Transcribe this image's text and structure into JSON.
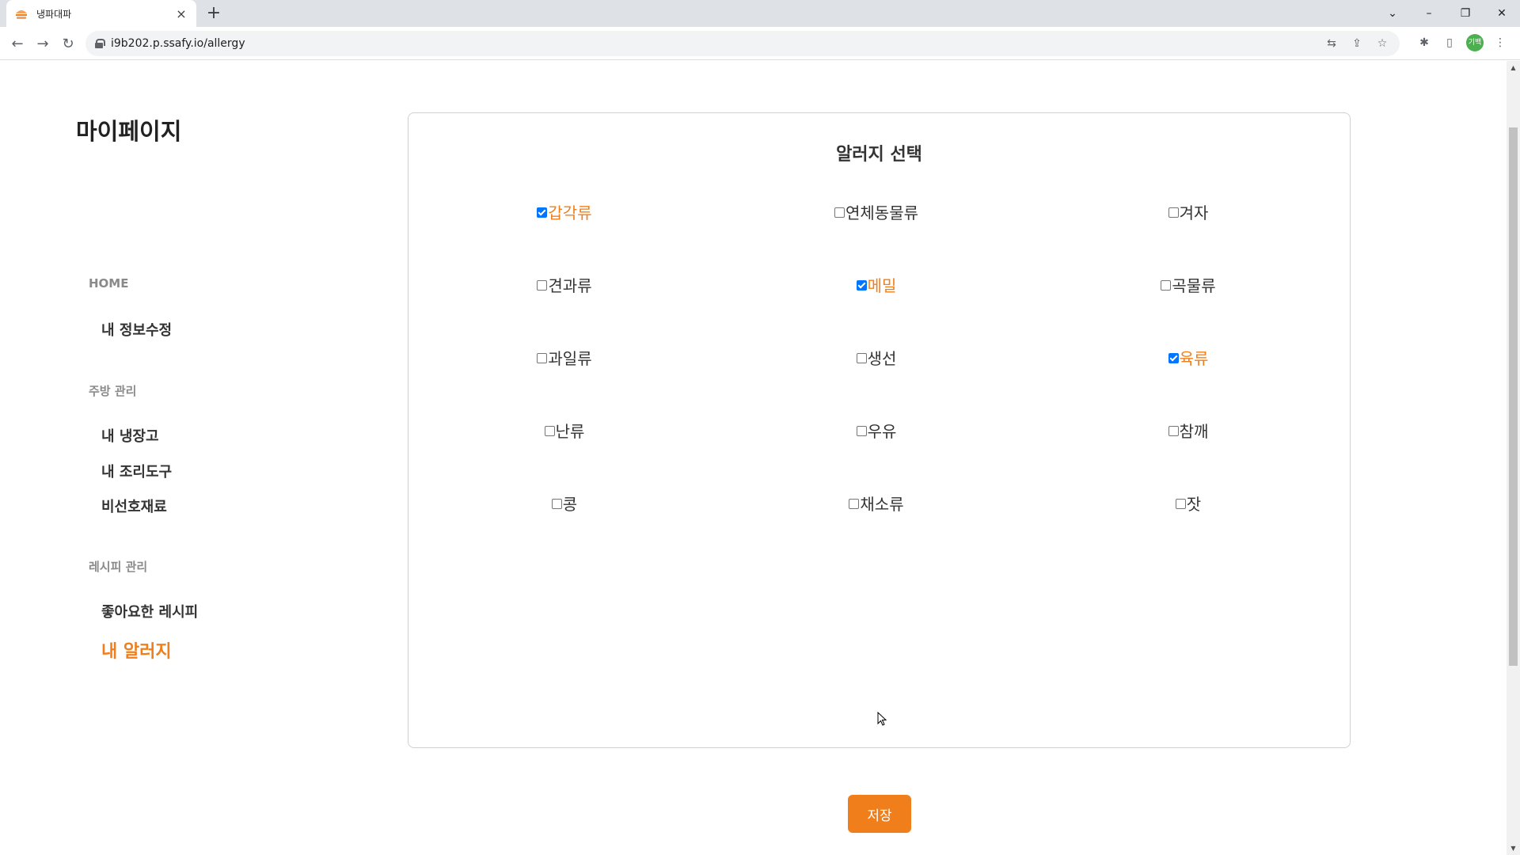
{
  "browser": {
    "tab_title": "냉파대파",
    "new_tab_icon": "plus-icon",
    "url": "i9b202.p.ssafy.io/allergy",
    "profile_initials": "기백"
  },
  "sidebar": {
    "title": "마이페이지",
    "home": "HOME",
    "home_items": [
      "내 정보수정"
    ],
    "kitchen_head": "주방 관리",
    "kitchen_items": [
      "내 냉장고",
      "내 조리도구",
      "비선호재료"
    ],
    "recipe_head": "레시피 관리",
    "recipe_items": [
      "좋아요한 레시피",
      "내 알러지"
    ],
    "active_item": "내 알러지"
  },
  "panel": {
    "title": "알러지 선택",
    "options": [
      {
        "label": "갑각류",
        "checked": true
      },
      {
        "label": "연체동물류",
        "checked": false
      },
      {
        "label": "겨자",
        "checked": false
      },
      {
        "label": "견과류",
        "checked": false
      },
      {
        "label": "메밀",
        "checked": true
      },
      {
        "label": "곡물류",
        "checked": false
      },
      {
        "label": "과일류",
        "checked": false
      },
      {
        "label": "생선",
        "checked": false
      },
      {
        "label": "육류",
        "checked": true
      },
      {
        "label": "난류",
        "checked": false
      },
      {
        "label": "우유",
        "checked": false
      },
      {
        "label": "참깨",
        "checked": false
      },
      {
        "label": "콩",
        "checked": false
      },
      {
        "label": "채소류",
        "checked": false
      },
      {
        "label": "잣",
        "checked": false
      }
    ]
  },
  "save_button": "저장",
  "colors": {
    "accent": "#f07f1b",
    "checkbox": "#0075ff"
  }
}
